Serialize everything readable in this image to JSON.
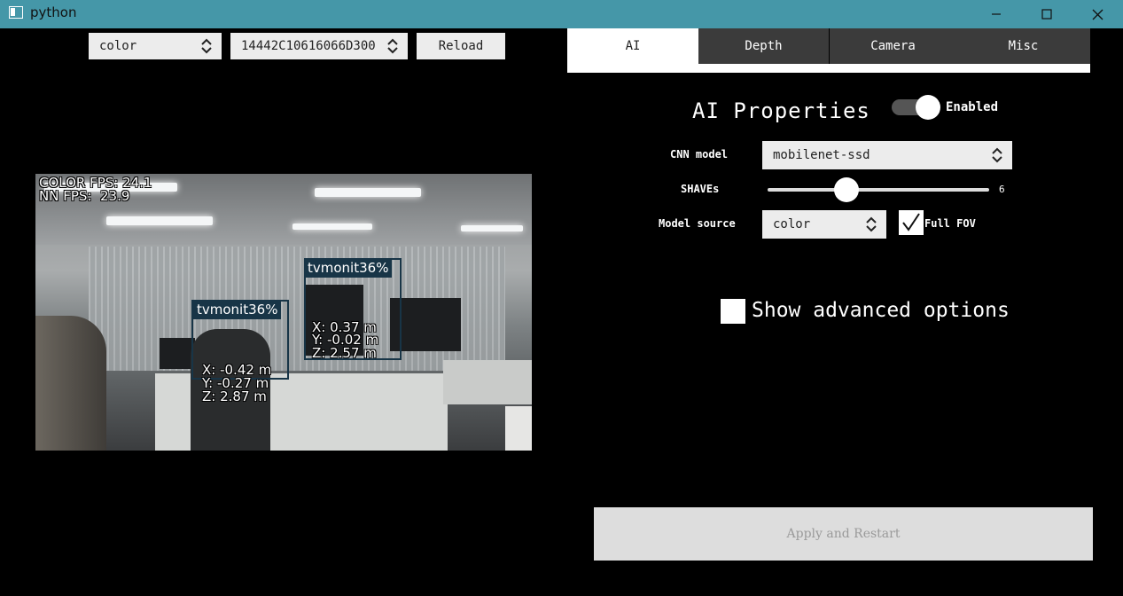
{
  "window": {
    "title": "python",
    "app_icon": "window-app-icon",
    "controls": [
      "minimize-icon",
      "maximize-icon",
      "close-icon"
    ]
  },
  "toolbar": {
    "source_select": "color",
    "device_select": "14442C10616066D300",
    "reload_label": "Reload"
  },
  "video": {
    "color_fps": "COLOR FPS: 24.1",
    "nn_fps": "NN FPS:  23.9",
    "detections": [
      {
        "label": "tvmonit36%",
        "x": "X: 0.37 m",
        "y": "Y: -0.02 m",
        "z": "Z: 2.57 m"
      },
      {
        "label": "tvmonit36%",
        "x": "X: -0.42 m",
        "y": "Y: -0.27 m",
        "z": "Z: 2.87 m"
      }
    ]
  },
  "tabs": [
    {
      "label": "AI",
      "active": true
    },
    {
      "label": "Depth",
      "active": false
    },
    {
      "label": "Camera",
      "active": false
    },
    {
      "label": "Misc",
      "active": false
    }
  ],
  "ai": {
    "title": "AI Properties",
    "enabled_label": "Enabled",
    "enabled": true,
    "cnn_label": "CNN model",
    "cnn_value": "mobilenet-ssd",
    "shaves_label": "SHAVEs",
    "shaves_value": "6",
    "shaves_fraction": 0.35,
    "model_source_label": "Model source",
    "model_source_value": "color",
    "full_fov_label": "Full FOV",
    "full_fov_checked": true,
    "advanced_label": "Show advanced options",
    "advanced_checked": false
  },
  "apply_label": "Apply and Restart",
  "colors": {
    "titlebar": "#4597a8",
    "tab_inactive": "#3b3b3b",
    "detection": "#183547",
    "background": "#000000"
  }
}
